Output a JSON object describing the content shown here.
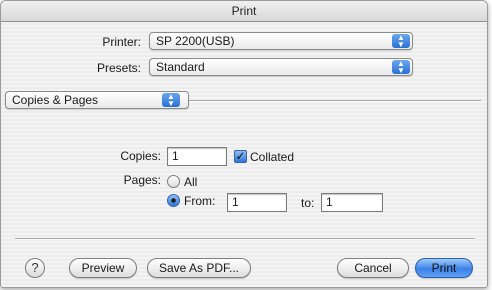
{
  "window": {
    "title": "Print"
  },
  "printer": {
    "label": "Printer:",
    "value": "SP 2200(USB)"
  },
  "presets": {
    "label": "Presets:",
    "value": "Standard"
  },
  "panel": {
    "value": "Copies & Pages"
  },
  "copies": {
    "label": "Copies:",
    "value": "1",
    "collated_label": "Collated",
    "collated_checked": true
  },
  "pages": {
    "label": "Pages:",
    "all_label": "All",
    "from_label": "From:",
    "from_value": "1",
    "to_label": "to:",
    "to_value": "1",
    "selected": "from"
  },
  "buttons": {
    "help": "?",
    "preview": "Preview",
    "save_pdf": "Save As PDF...",
    "cancel": "Cancel",
    "print": "Print"
  },
  "icons": {
    "popup_arrows": "updown-arrows-icon",
    "check": "checkmark-icon"
  },
  "colors": {
    "accent": "#3b82e8"
  }
}
